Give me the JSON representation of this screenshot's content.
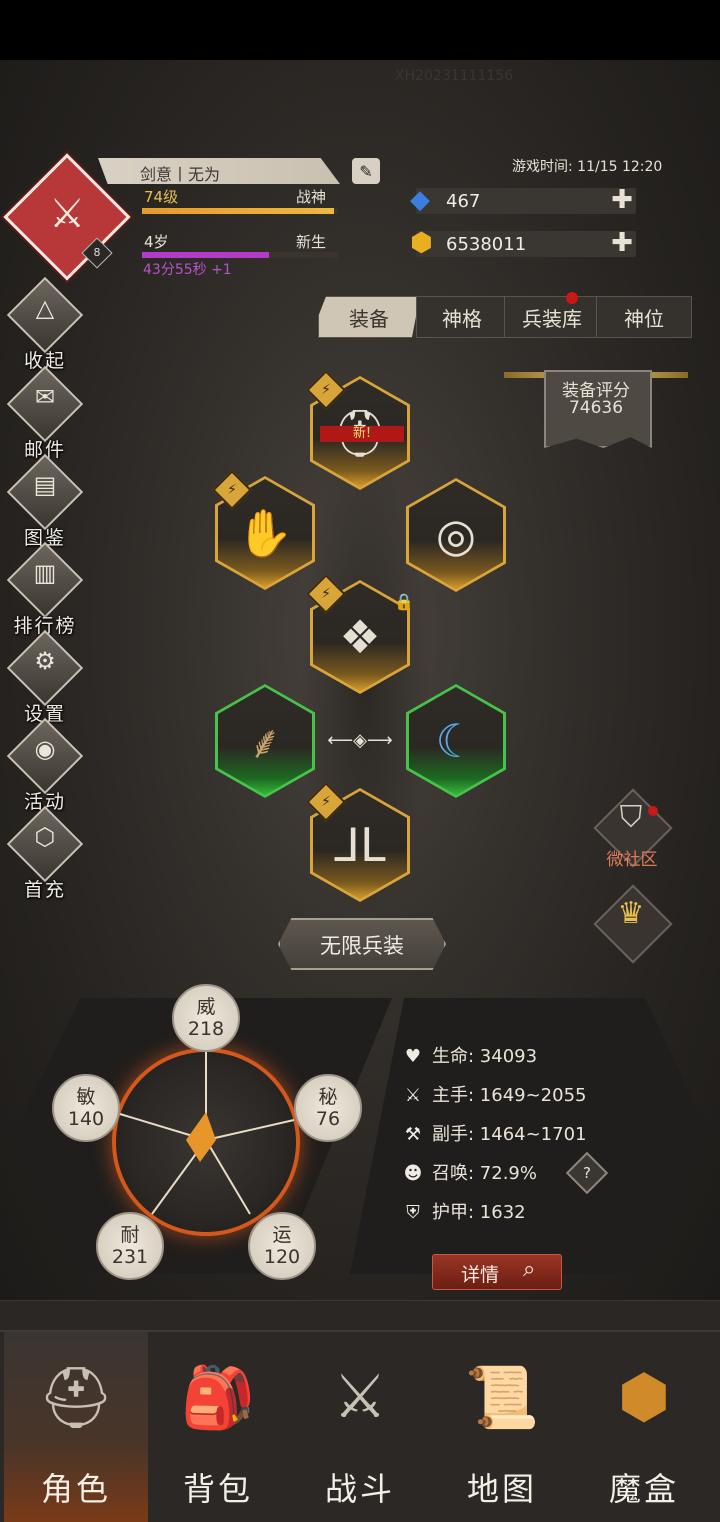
{
  "watermark": "XH20231111156",
  "player": {
    "name": "剑意丨无为",
    "avatar_level": "8",
    "level": "74级",
    "level_title": "战神",
    "level_progress": 0.98,
    "age": "4岁",
    "age_title": "新生",
    "age_progress": 0.65,
    "age_timer": "43分55秒 +1"
  },
  "game_time": "游戏时间: 11/15 12:20",
  "currency": {
    "gems": "467",
    "gold": "6538011"
  },
  "sidebar": [
    {
      "label": "收起",
      "icon": "collapse-icon"
    },
    {
      "label": "邮件",
      "icon": "mail-icon"
    },
    {
      "label": "图鉴",
      "icon": "book-icon"
    },
    {
      "label": "排行榜",
      "icon": "ranking-icon"
    },
    {
      "label": "设置",
      "icon": "gear-icon"
    },
    {
      "label": "活动",
      "icon": "event-icon"
    },
    {
      "label": "首充",
      "icon": "first-recharge-icon"
    }
  ],
  "tabs": [
    "装备",
    "神格",
    "兵装库",
    "神位"
  ],
  "active_tab": "装备",
  "equip_score": {
    "label": "装备评分",
    "value": "74636"
  },
  "equipment": {
    "new_tag": "新!"
  },
  "infinite_button": "无限兵装",
  "community_label": "微社区",
  "stats": {
    "wei": {
      "name": "威",
      "value": "218"
    },
    "mi": {
      "name": "秘",
      "value": "76"
    },
    "yun": {
      "name": "运",
      "value": "120"
    },
    "nai": {
      "name": "耐",
      "value": "231"
    },
    "min": {
      "name": "敏",
      "value": "140"
    }
  },
  "attributes": [
    {
      "label": "生命: 34093",
      "icon": "heart-icon"
    },
    {
      "label": "主手: 1649~2055",
      "icon": "sword-icon"
    },
    {
      "label": "副手: 1464~1701",
      "icon": "offhand-icon"
    },
    {
      "label": "召唤: 72.9%",
      "icon": "summon-icon"
    },
    {
      "label": "护甲: 1632",
      "icon": "armor-icon"
    }
  ],
  "help_label": "?",
  "detail_button": "详情",
  "nav": [
    {
      "label": "角色",
      "icon": "helmet-icon"
    },
    {
      "label": "背包",
      "icon": "backpack-icon"
    },
    {
      "label": "战斗",
      "icon": "shield-sword-icon"
    },
    {
      "label": "地图",
      "icon": "scroll-map-icon"
    },
    {
      "label": "魔盒",
      "icon": "magic-box-icon"
    }
  ],
  "colors": {
    "level_bar": "#f1b840",
    "age_bar": "#b23bc8",
    "active_nav": "#7a3a18",
    "accent_orange": "#d4581c"
  }
}
